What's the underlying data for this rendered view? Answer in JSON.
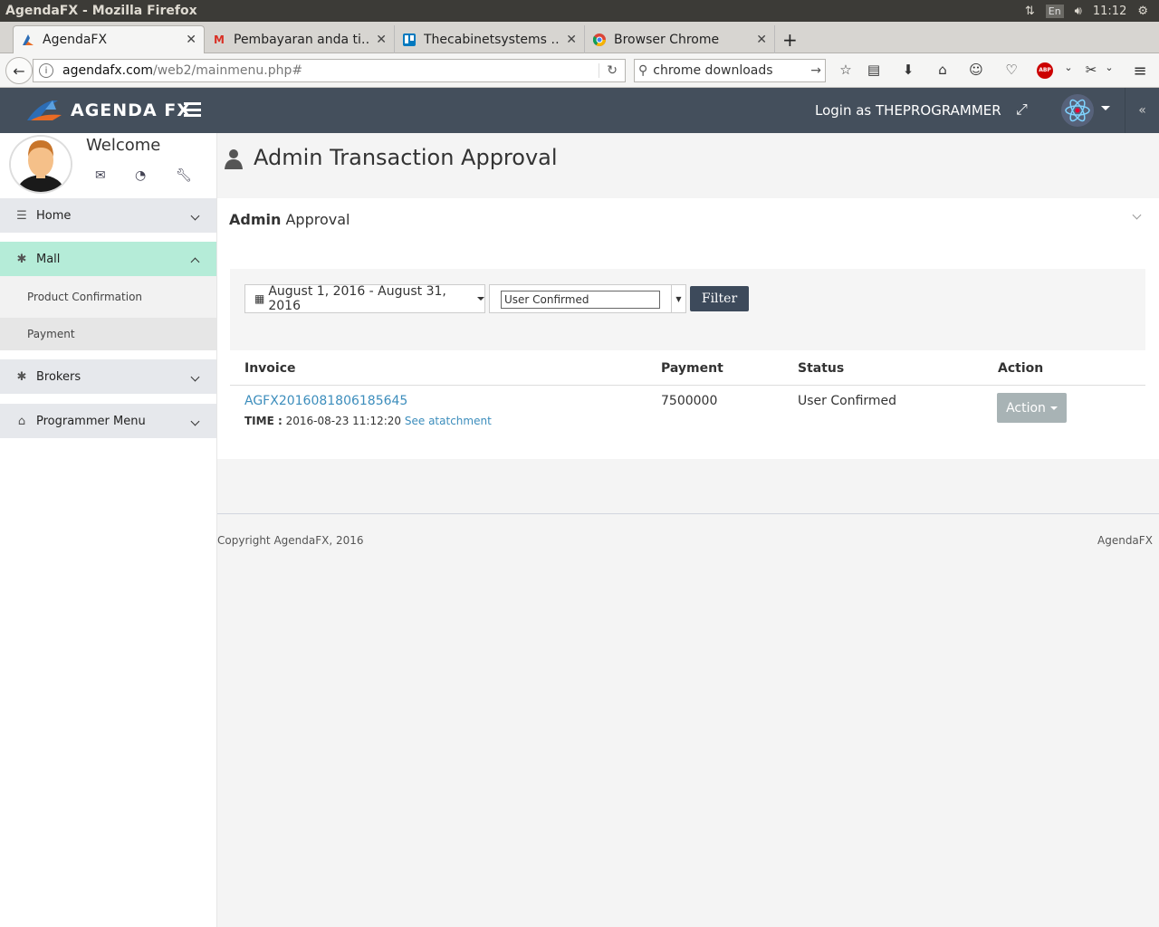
{
  "os": {
    "window_title": "AgendaFX - Mozilla Firefox",
    "lang": "En",
    "clock": "11:12"
  },
  "browser": {
    "tabs": [
      {
        "label": "AgendaFX",
        "favicon": "agendafx-logo-icon"
      },
      {
        "label": "Pembayaran anda ti…",
        "favicon": "gmail-icon"
      },
      {
        "label": "Thecabinetsystems …",
        "favicon": "trello-icon"
      },
      {
        "label": "Browser Chrome",
        "favicon": "chrome-icon"
      }
    ],
    "url_domain": "agendafx.com",
    "url_path": "/web2/mainmenu.php#",
    "search_value": "chrome downloads",
    "abp_label": "ABP"
  },
  "header": {
    "brand": "AGENDA FX",
    "login_text": "Login as THEPROGRAMMER",
    "collapse_glyph": "«"
  },
  "sidebar": {
    "welcome": "Welcome",
    "menu": [
      {
        "label": "Home",
        "icon": "list-icon",
        "expanded": false
      },
      {
        "label": "Mall",
        "icon": "asterisk-icon",
        "expanded": true
      },
      {
        "label": "Brokers",
        "icon": "asterisk-icon",
        "expanded": false
      },
      {
        "label": "Programmer Menu",
        "icon": "home-icon",
        "expanded": false
      }
    ],
    "mall_sub": [
      "Product Confirmation",
      "Payment"
    ]
  },
  "colors": {
    "header_bg": "#444f5c",
    "active_menu_bg": "#b5ecd8",
    "link": "#3c8dbc",
    "filter_btn": "#3d4a5b",
    "action_btn": "#a8b3b5"
  },
  "page": {
    "title": "Admin Transaction Approval",
    "panel_title_bold": "Admin",
    "panel_title_rest": "Approval",
    "filter": {
      "date_range": "August 1, 2016 - August 31, 2016",
      "status_selected": "User Confirmed",
      "button": "Filter"
    },
    "table": {
      "headers": [
        "Invoice",
        "Payment",
        "Status",
        "Action"
      ],
      "rows": [
        {
          "invoice": "AGFX2016081806185645",
          "time_label": "TIME :",
          "time": "2016-08-23 11:12:20",
          "attachment_link": "See atatchment",
          "payment": "7500000",
          "status": "User Confirmed",
          "action": "Action"
        }
      ]
    }
  },
  "footer": {
    "copyright": "Copyright AgendaFX, 2016",
    "brand": "AgendaFX"
  }
}
